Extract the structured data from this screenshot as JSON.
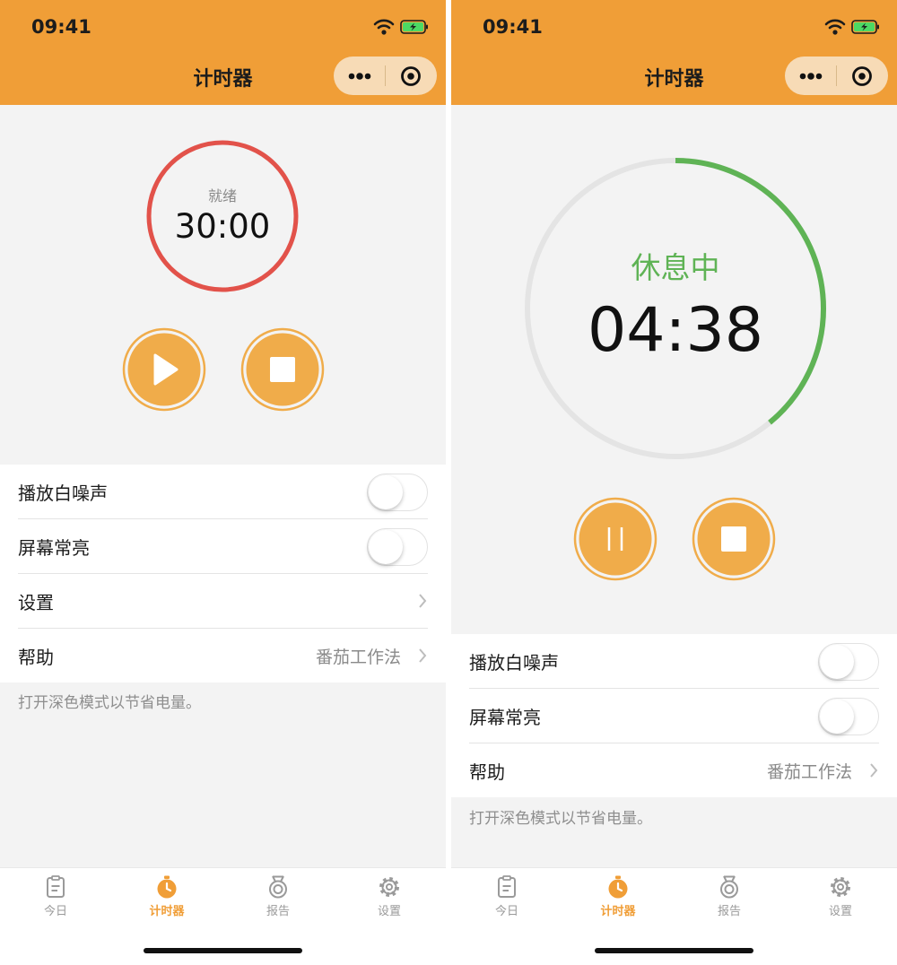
{
  "status": {
    "time": "09:41"
  },
  "nav": {
    "title": "计时器"
  },
  "timer_ready": {
    "state_label": "就绪",
    "time": "30:00",
    "ring_color": "#e2524a",
    "progress": 1.0
  },
  "timer_rest": {
    "state_label": "休息中",
    "time": "04:38",
    "ring_color": "#5fb355",
    "track_color": "#e4e4e4",
    "progress": 0.39
  },
  "settings": {
    "white_noise": {
      "label": "播放白噪声",
      "on": false
    },
    "keep_screen_on": {
      "label": "屏幕常亮",
      "on": false
    },
    "settings": {
      "label": "设置"
    },
    "help": {
      "label": "帮助",
      "value": "番茄工作法"
    },
    "footnote": "打开深色模式以节省电量。"
  },
  "tabs": [
    {
      "label": "今日",
      "icon": "clipboard-icon",
      "active": false
    },
    {
      "label": "计时器",
      "icon": "stopwatch-icon",
      "active": true
    },
    {
      "label": "报告",
      "icon": "medal-icon",
      "active": false
    },
    {
      "label": "设置",
      "icon": "gear-icon",
      "active": false
    }
  ],
  "colors": {
    "accent": "#f09e37",
    "button": "#f0ac4a",
    "inactive_tab": "#9a9a9a"
  }
}
